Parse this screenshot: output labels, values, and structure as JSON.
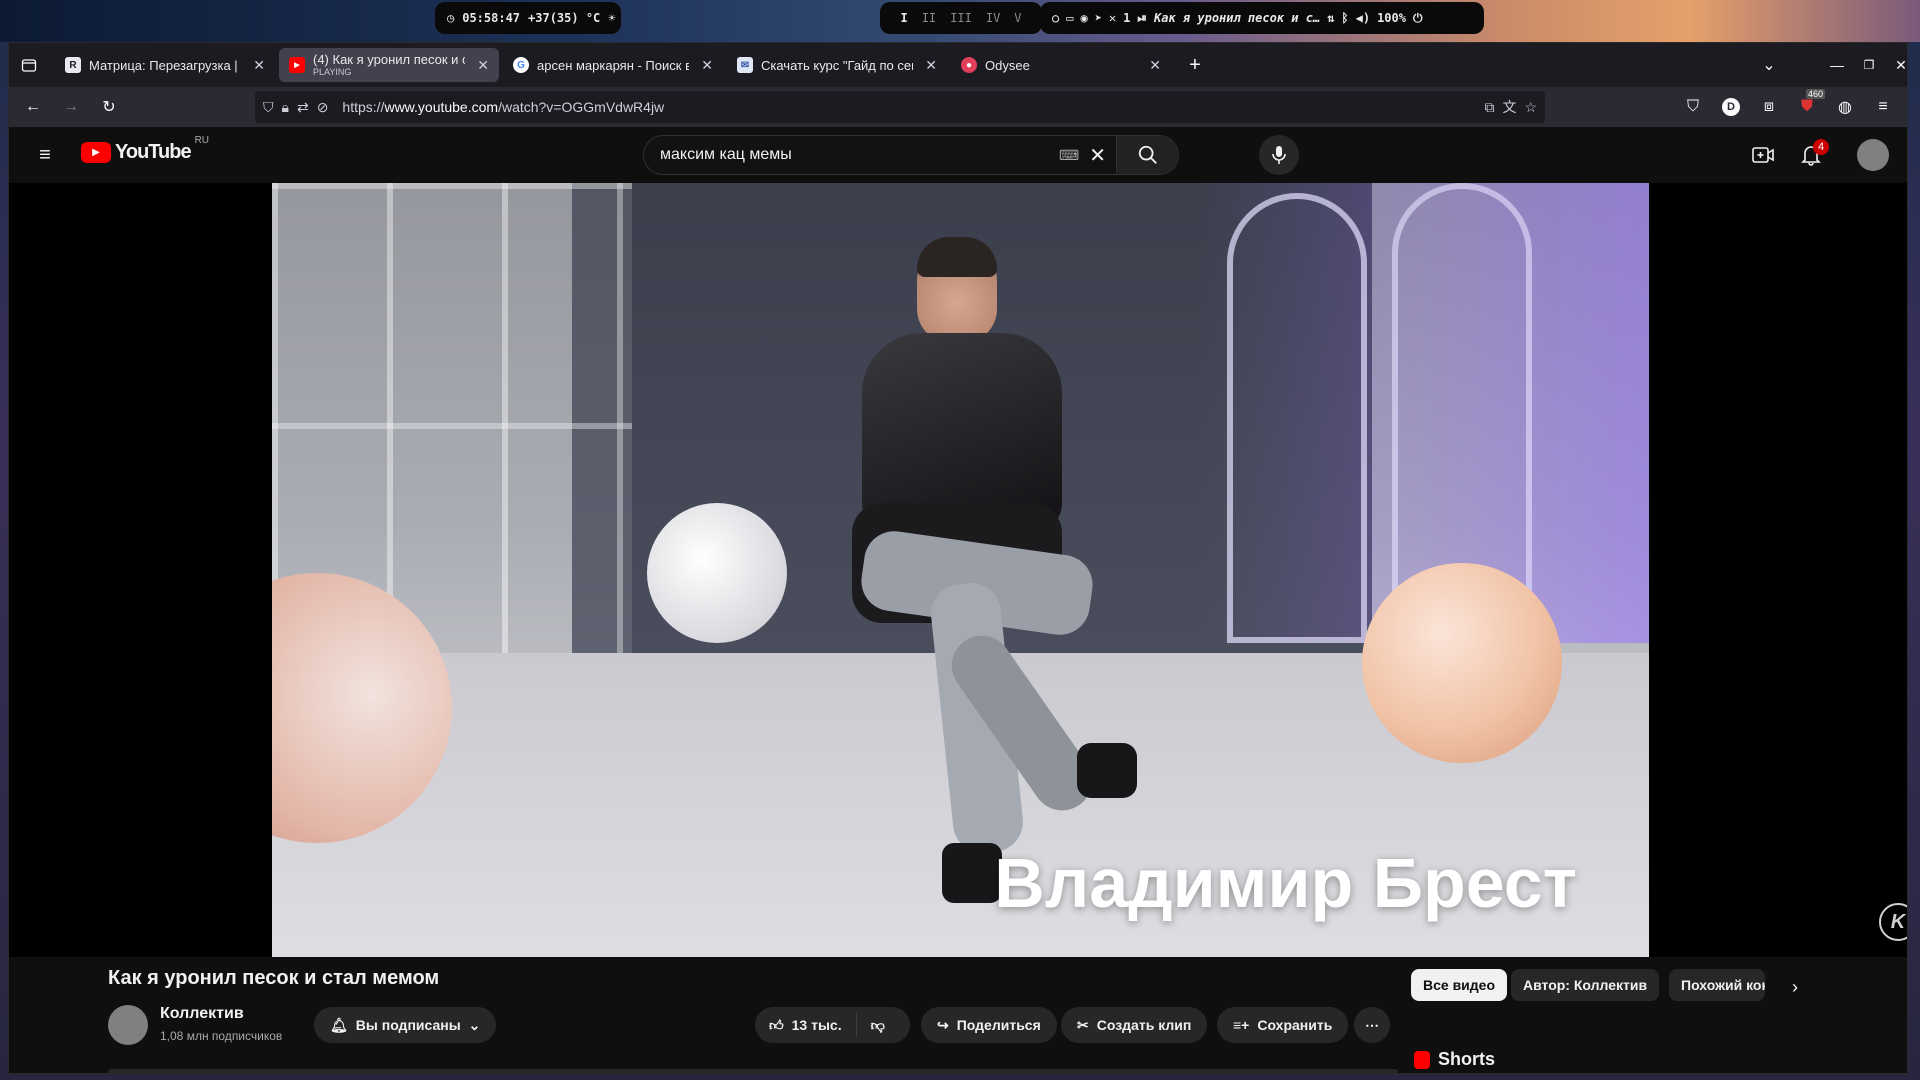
{
  "desktop": {
    "clock": "05:58:47",
    "temp": "+37(35) °C",
    "workspaces": [
      "I",
      "II",
      "III",
      "IV",
      "V"
    ],
    "media_index": "1",
    "media_title": "Как я уронил песок и с…",
    "volume": "100%"
  },
  "browser": {
    "tabs": [
      {
        "title": "Матрица: Перезагрузка |",
        "favicon": "R"
      },
      {
        "title": "(4) Как я уронил песок и с",
        "subtitle": "PLAYING",
        "favicon": "youtube",
        "active": true
      },
      {
        "title": "арсен маркарян - Поиск в",
        "favicon": "google"
      },
      {
        "title": "Скачать курс \"Гайд по сек",
        "favicon": "mail"
      },
      {
        "title": "Odysee",
        "favicon": "odysee"
      }
    ],
    "url_prefix": "https://",
    "url_host": "www.youtube.com",
    "url_path": "/watch?v=OGGmVdwR4jw",
    "extension_badge": "460"
  },
  "youtube": {
    "logo_text": "YouTube",
    "region": "RU",
    "search_value": "максим кац мемы",
    "notifications_count": "4",
    "video": {
      "overlay_caption": "Владимир Брест",
      "watermark": "K",
      "title": "Как я уронил песок и стал мемом"
    },
    "channel": {
      "name": "Коллектив",
      "subscribers": "1,08 млн подписчиков",
      "subscribed_label": "Вы подписаны"
    },
    "actions": {
      "likes": "13 тыс.",
      "share": "Поделиться",
      "clip": "Создать клип",
      "save": "Сохранить"
    },
    "chips": [
      "Все видео",
      "Автор: Коллектив",
      "Похожий кон"
    ],
    "shorts_label": "Shorts"
  },
  "colors": {
    "yt_red": "#ff0000",
    "bg": "#0f0f0f",
    "chip": "#272727"
  }
}
